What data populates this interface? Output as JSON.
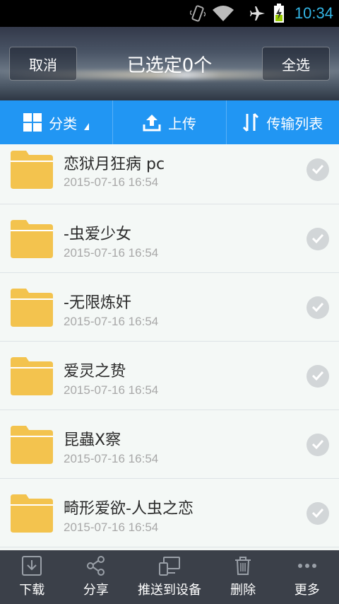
{
  "status_bar": {
    "time": "10:34",
    "icons": [
      "vibrate-icon",
      "wifi-icon",
      "airplane-icon",
      "battery-charging-icon"
    ],
    "time_color": "#33b5e5"
  },
  "header": {
    "cancel_label": "取消",
    "title": "已选定0个",
    "select_all_label": "全选"
  },
  "toolbar": {
    "category_label": "分类",
    "upload_label": "上传",
    "transfer_list_label": "传输列表",
    "accent": "#2196f3"
  },
  "files": [
    {
      "name": "恋狱月狂病 pc",
      "date": "2015-07-16  16:54"
    },
    {
      "name": "-虫爱少女",
      "date": "2015-07-16  16:54"
    },
    {
      "name": "-无限炼奸",
      "date": "2015-07-16  16:54"
    },
    {
      "name": "爱灵之贽",
      "date": "2015-07-16  16:54"
    },
    {
      "name": "昆蟲X察",
      "date": "2015-07-16  16:54"
    },
    {
      "name": "畸形爱欲-人虫之恋",
      "date": "2015-07-16  16:54"
    }
  ],
  "bottom_bar": {
    "download_label": "下载",
    "share_label": "分享",
    "push_label": "推送到设备",
    "delete_label": "删除",
    "more_label": "更多"
  }
}
